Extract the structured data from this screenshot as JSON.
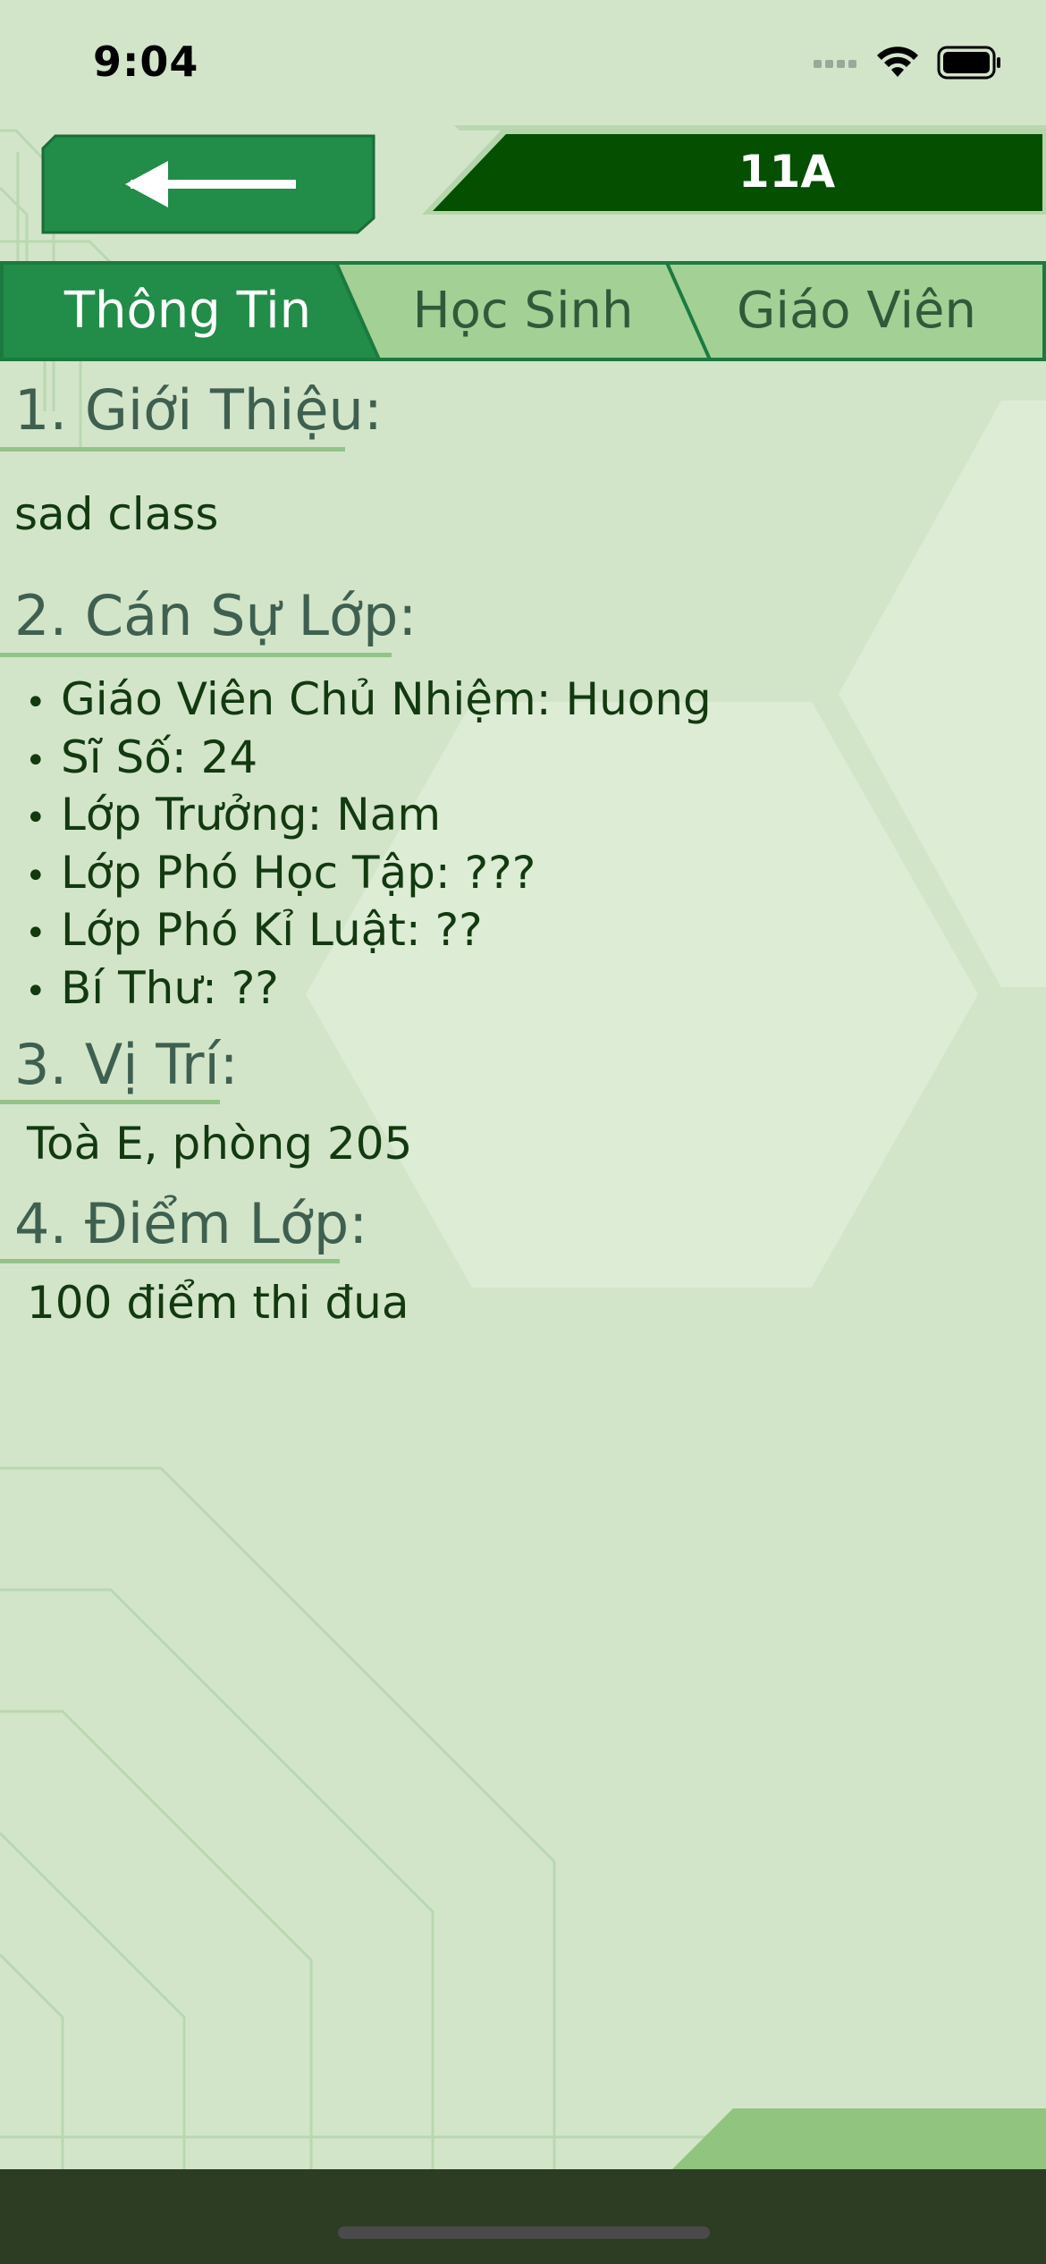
{
  "status_bar": {
    "time": "9:04"
  },
  "header": {
    "back_icon": "arrow-left-icon",
    "title": "11A"
  },
  "tabs": [
    {
      "label": "Thông Tin",
      "active": true
    },
    {
      "label": "Học Sinh",
      "active": false
    },
    {
      "label": "Giáo Viên",
      "active": false
    }
  ],
  "sections": {
    "intro": {
      "heading": "1. Giới Thiệu:",
      "text": "sad class"
    },
    "officers": {
      "heading": "2. Cán Sự Lớp:",
      "items": [
        "Giáo Viên Chủ Nhiệm: Huong",
        "Sĩ Số: 24",
        "Lớp Trưởng: Nam",
        "Lớp Phó Học Tập: ???",
        "Lớp Phó Kỉ Luật: ??",
        "Bí Thư: ??"
      ]
    },
    "location": {
      "heading": "3. Vị Trí:",
      "text": "Toà E, phòng 205"
    },
    "score": {
      "heading": "4. Điểm Lớp:",
      "text": "100 điểm thi đua"
    }
  },
  "colors": {
    "background": "#d3e5c9",
    "accent": "#218d48",
    "banner": "#054f00",
    "tab_inactive": "#a3d095",
    "bottom_bar": "#2c3d24"
  }
}
